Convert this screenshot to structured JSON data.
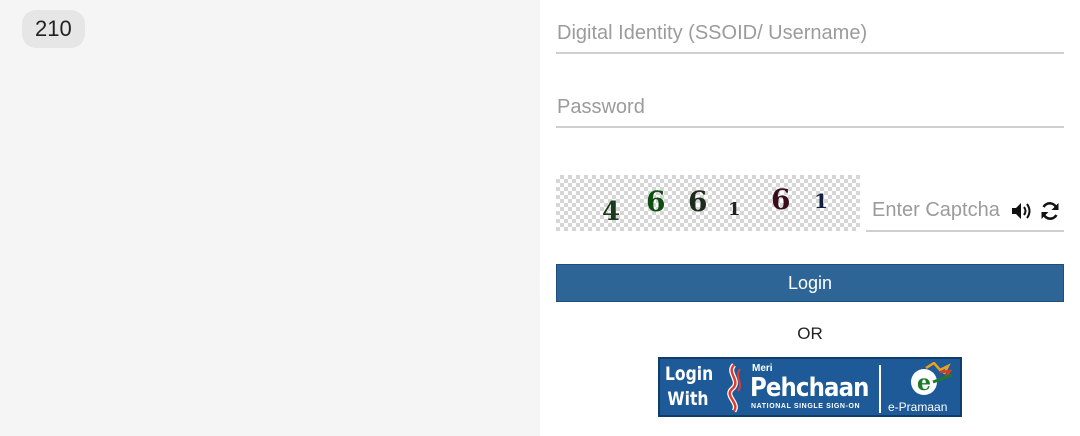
{
  "badge": {
    "text": "210"
  },
  "form": {
    "username_placeholder": "Digital Identity (SSOID/ Username)",
    "password_placeholder": "Password",
    "captcha_digits": [
      "4",
      "6",
      "6",
      "1",
      "6",
      "1"
    ],
    "captcha_placeholder": "Enter Captcha",
    "login_label": "Login",
    "or_label": "OR"
  },
  "icons": {
    "audio": "speaker-icon",
    "refresh": "refresh-icon"
  },
  "sso": {
    "login_with_line1": "Login",
    "login_with_line2": "With",
    "meri": "Meri",
    "pehchaan": "Pehchaan",
    "subtitle": "NATIONAL SINGLE SIGN-ON",
    "epramaan": "e-Pramaan"
  },
  "colors": {
    "login_button": "#2d6597",
    "sso_banner": "#1d5a97",
    "left_panel": "#f5f5f5"
  }
}
